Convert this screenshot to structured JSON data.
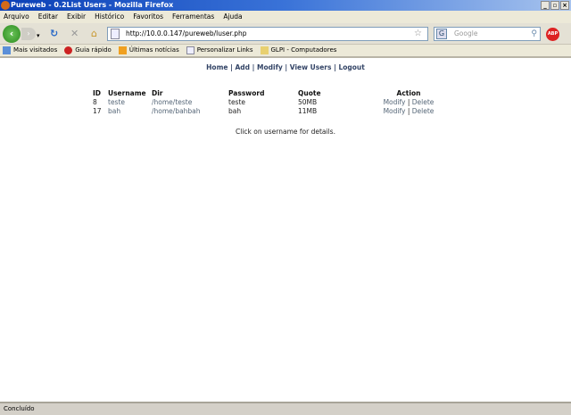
{
  "window": {
    "title": "Pureweb - 0.2List Users - Mozilla Firefox"
  },
  "menu": [
    "Arquivo",
    "Editar",
    "Exibir",
    "Histórico",
    "Favoritos",
    "Ferramentas",
    "Ajuda"
  ],
  "toolbar": {
    "url": "http://10.0.0.147/pureweb/luser.php",
    "search_placeholder": "Google",
    "abp": "ABP"
  },
  "bookmarks": [
    "Mais visitados",
    "Guia rápido",
    "Últimas notícias",
    "Personalizar Links",
    "GLPI - Computadores"
  ],
  "nav": {
    "home": "Home",
    "add": "Add",
    "modify": "Modify",
    "view_users": "View Users",
    "logout": "Logout",
    "sep": "|"
  },
  "table": {
    "headers": {
      "id": "ID",
      "username": "Username",
      "dir": "Dir",
      "password": "Password",
      "quote": "Quote",
      "action": "Action"
    },
    "rows": [
      {
        "id": "8",
        "username": "teste",
        "dir": "/home/teste",
        "password": "teste",
        "quote": "50MB",
        "modify": "Modify",
        "delete": "Delete"
      },
      {
        "id": "17",
        "username": "bah",
        "dir": "/home/bahbah",
        "password": "bah",
        "quote": "11MB",
        "modify": "Modify",
        "delete": "Delete"
      }
    ]
  },
  "note": "Click on username for details.",
  "status": "Concluído"
}
